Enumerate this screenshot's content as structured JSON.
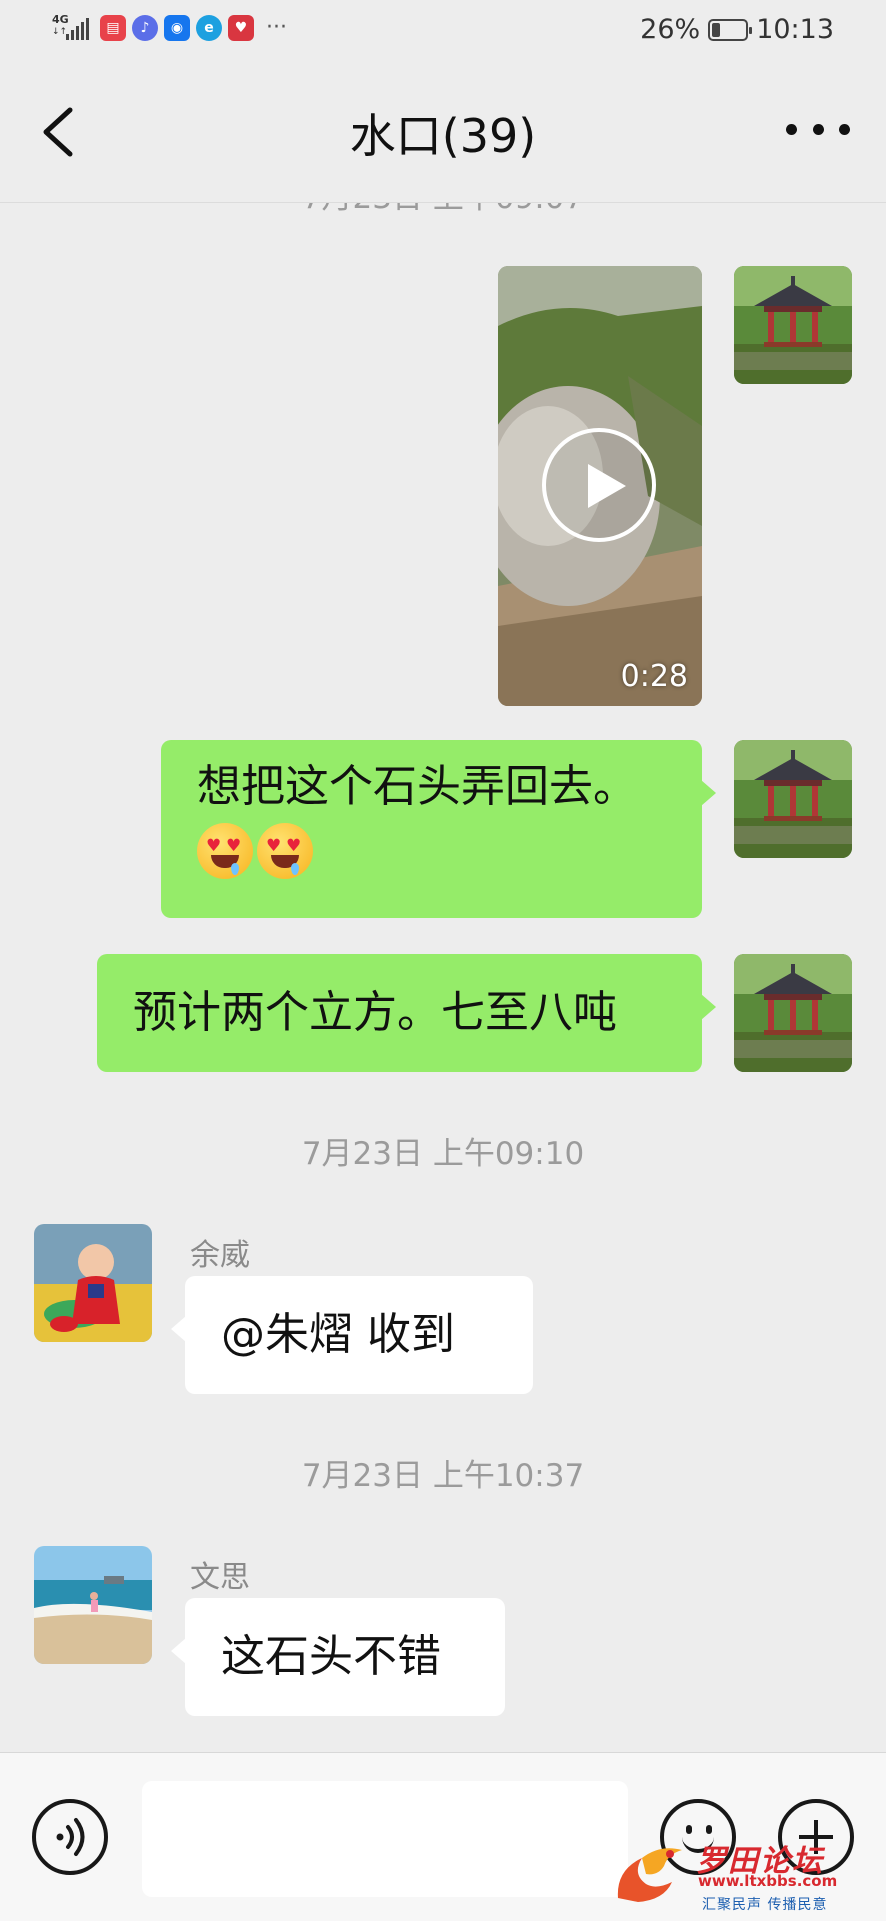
{
  "status_bar": {
    "network_label": "4G",
    "battery_percent": "26%",
    "battery_level": 0.26,
    "time": "10:13",
    "overflow_dots": "···"
  },
  "header": {
    "title": "水口(39)"
  },
  "chat": {
    "timestamp_partial": "7月23日 上午09:07",
    "messages": [
      {
        "type": "video",
        "from": "me",
        "duration": "0:28"
      },
      {
        "type": "text",
        "from": "me",
        "text": "想把这个石头弄回去。",
        "emoji": "drooling-heart-eyes",
        "emoji_count": 2
      },
      {
        "type": "text",
        "from": "me",
        "text": "预计两个立方。七至八吨"
      }
    ],
    "timestamp_1": "7月23日 上午09:10",
    "message_yuwei": {
      "sender": "余威",
      "text": "@朱熠  收到"
    },
    "timestamp_2": "7月23日 上午10:37",
    "message_wensi": {
      "sender": "文思",
      "text": "这石头不错"
    }
  },
  "input_bar": {
    "placeholder": ""
  },
  "watermark": {
    "brand": "罗田论坛",
    "url": "www.ltxbbs.com",
    "slogan": "汇聚民声  传播民意"
  },
  "colors": {
    "background": "#ededed",
    "my_bubble": "#95ec69",
    "their_bubble": "#ffffff",
    "timestamp_text": "#9b9b9b",
    "watermark_red": "#d8292f"
  }
}
